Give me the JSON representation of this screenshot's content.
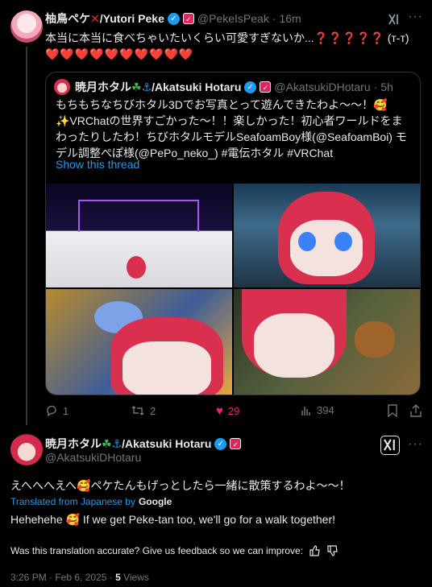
{
  "tweet": {
    "display_name": "柚鳥ペケ",
    "display_name_suffix": "/Yutori Peke",
    "handle": "@PekeIsPeak",
    "time": "16m",
    "text_line1": "本当に本当に食べちゃいたいくらい可愛すぎないか...❓❓❓❓❓ (т-т)",
    "hearts": "❤️❤️❤️❤️❤️❤️❤️❤️❤️❤️"
  },
  "quote": {
    "display_name": "暁月ホタル",
    "display_name_suffix": "/Akatsuki Hotaru",
    "handle": "@AkatsukiDHotaru",
    "time": "5h",
    "text": "もちもちなちびホタル3Dでお写真とって遊んできたわよ〜〜！🥰✨VRChatの世界すごかった〜！！楽しかった！初心者ワールドをまわったりしたわ！ちびホタルモデルSeafoamBoy様(@SeafoamBoi) モデル調整ぺぽ様(@PePo_neko_) #電伝ホタル #VRChat",
    "show_thread": "Show this thread"
  },
  "actions": {
    "replies": "1",
    "retweets": "2",
    "likes": "29",
    "views": "394"
  },
  "reply": {
    "display_name": "暁月ホタル",
    "display_name_suffix": "/Akatsuki Hotaru",
    "handle": "@AkatsukiDHotaru",
    "text_jp": "えへへへえへ🥰ペケたんもげっとしたら一緒に散策するわよ〜〜！",
    "translated_from": "Translated from Japanese by",
    "google": "Google",
    "text_en": "Hehehehe 🥰 If we get Peke-tan too, we'll go for a walk together!",
    "feedback_prompt": "Was this translation accurate? Give us feedback so we can improve:",
    "timestamp": "3:26 PM · Feb 6, 2025 · ",
    "views_count": "5",
    "views_label": " Views"
  },
  "colors": {
    "background": "#000000",
    "text": "#e7e9ea",
    "muted": "#71767b",
    "link": "#1d9bf0",
    "like": "#f91880"
  }
}
